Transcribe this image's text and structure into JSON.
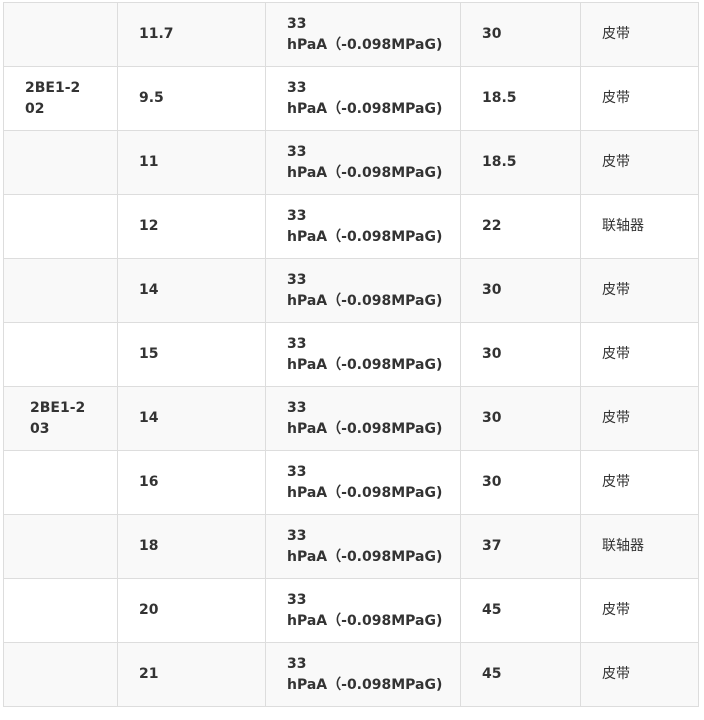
{
  "rows": [
    {
      "model": "",
      "flow": "11.7",
      "vac_line1": "33",
      "vac_line2": "hPaA（-0.098MPaG)",
      "power": "30",
      "drive": "皮带"
    },
    {
      "model": "2BE1-202",
      "flow": "9.5",
      "vac_line1": "33",
      "vac_line2": "hPaA（-0.098MPaG)",
      "power": "18.5",
      "drive": "皮带"
    },
    {
      "model": "",
      "flow": "11",
      "vac_line1": "33",
      "vac_line2": "hPaA（-0.098MPaG)",
      "power": "18.5",
      "drive": "皮带"
    },
    {
      "model": "",
      "flow": "12",
      "vac_line1": "33",
      "vac_line2": "hPaA（-0.098MPaG)",
      "power": "22",
      "drive": "联轴器"
    },
    {
      "model": "",
      "flow": "14",
      "vac_line1": "33",
      "vac_line2": "hPaA（-0.098MPaG)",
      "power": "30",
      "drive": "皮带"
    },
    {
      "model": "",
      "flow": "15",
      "vac_line1": "33",
      "vac_line2": "hPaA（-0.098MPaG)",
      "power": "30",
      "drive": "皮带"
    },
    {
      "model": "2BE1-203",
      "flow": "14",
      "vac_line1": "33",
      "vac_line2": "hPaA（-0.098MPaG)",
      "power": "30",
      "drive": "皮带"
    },
    {
      "model": "",
      "flow": "16",
      "vac_line1": "33",
      "vac_line2": "hPaA（-0.098MPaG)",
      "power": "30",
      "drive": "皮带"
    },
    {
      "model": "",
      "flow": "18",
      "vac_line1": "33",
      "vac_line2": "hPaA（-0.098MPaG)",
      "power": "37",
      "drive": "联轴器"
    },
    {
      "model": "",
      "flow": "20",
      "vac_line1": "33",
      "vac_line2": "hPaA（-0.098MPaG)",
      "power": "45",
      "drive": "皮带"
    },
    {
      "model": "",
      "flow": "21",
      "vac_line1": "33",
      "vac_line2": "hPaA（-0.098MPaG)",
      "power": "45",
      "drive": "皮带"
    }
  ]
}
